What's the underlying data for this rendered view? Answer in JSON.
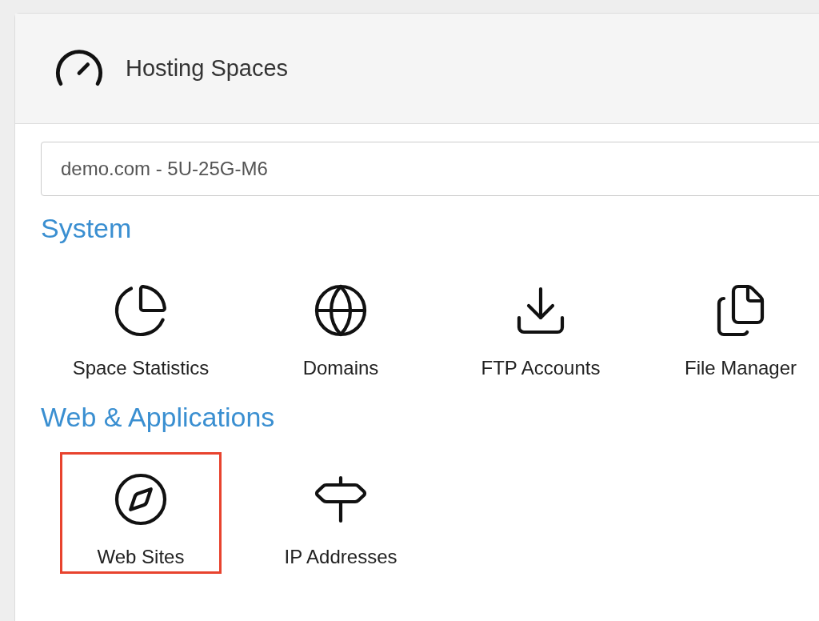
{
  "panel": {
    "title": "Hosting Spaces"
  },
  "space_selector": {
    "value": "demo.com - 5U-25G-M6"
  },
  "sections": [
    {
      "title": "System",
      "items": [
        {
          "label": "Space Statistics",
          "kind": "statistics",
          "highlighted": false
        },
        {
          "label": "Domains",
          "kind": "domains",
          "highlighted": false
        },
        {
          "label": "FTP Accounts",
          "kind": "ftp",
          "highlighted": false
        },
        {
          "label": "File Manager",
          "kind": "files",
          "highlighted": false
        }
      ]
    },
    {
      "title": "Web & Applications",
      "items": [
        {
          "label": "Web Sites",
          "kind": "websites",
          "highlighted": true
        },
        {
          "label": "IP Addresses",
          "kind": "ip",
          "highlighted": false
        }
      ]
    }
  ]
}
